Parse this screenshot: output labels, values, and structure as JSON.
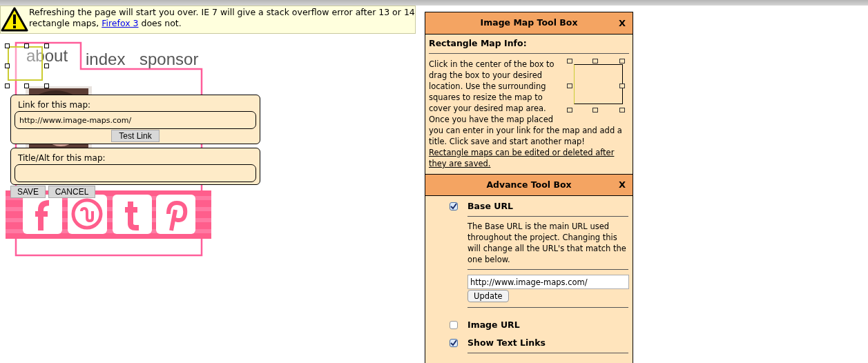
{
  "warning": {
    "text": "Refreshing the page will start you over. IE 7 will give a stack overflow error after 13 or 14 rectangle maps,",
    "link": "Firefox 3",
    "after": "does not."
  },
  "image": {
    "kind": "picture",
    "nav": [
      "about",
      "index",
      "sponsor"
    ]
  },
  "map_form": {
    "link_label": "Link for this map:",
    "link_value": "http://www.image-maps.com/",
    "test_button": "Test Link",
    "title_label": "Title/Alt for this map:",
    "save": "SAVE",
    "cancel": "CANCEL"
  },
  "toolbox": {
    "title": "Image Map Tool Box",
    "close": "X",
    "section": "Rectangle Map Info:",
    "text_beside": "Click in the center of the box to drag the box to your desired location. Use the surrounding squares to resize the map to cover your desired map area. Once you have the map placed",
    "text": "you can enter in your link for the map and add a title. Click save and start another map!",
    "link": "Rectangle maps can be edited or deleted after they are saved."
  },
  "advance": {
    "title": "Advance Tool Box",
    "close": "X",
    "options": [
      {
        "label": "Base URL",
        "checked": true,
        "description": "The Base URL is the main URL used throughout the project. Changing this will change all the URL's that match the one below.",
        "url": "http://www.image-maps.com/",
        "button": "Update"
      },
      {
        "label": "Image URL",
        "checked": false
      },
      {
        "label": "Show Text Links",
        "checked": true
      }
    ]
  }
}
